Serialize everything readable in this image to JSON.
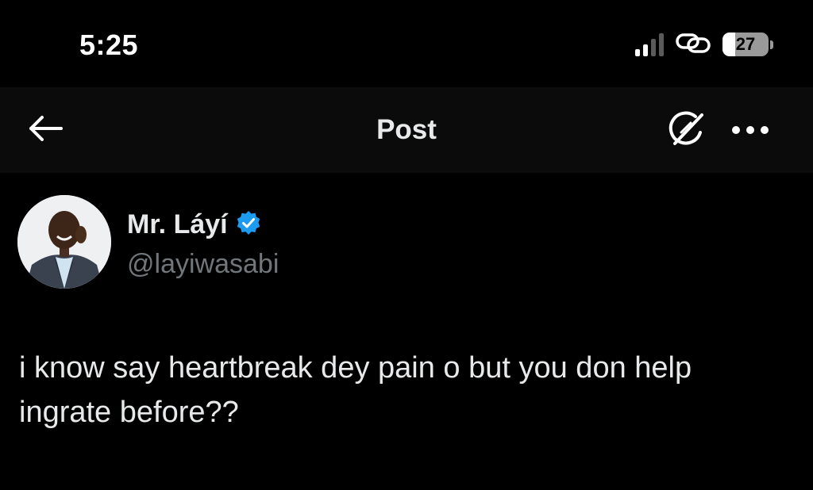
{
  "status_bar": {
    "time": "5:25",
    "battery_level": "27",
    "battery_fraction": 0.27,
    "signal_bars_active": 2,
    "signal_bars_total": 4,
    "icons": [
      "cellular-signal-icon",
      "link-icon",
      "battery-icon"
    ]
  },
  "nav": {
    "title": "Post",
    "back_icon": "arrow-left-icon",
    "grok_icon": "grok-icon",
    "more_icon": "more-horizontal-icon"
  },
  "post": {
    "author_name": "Mr. Láyí",
    "handle": "@layiwasabi",
    "verified": true,
    "verified_color": "#1d9bf0",
    "text": "i know say heartbreak dey pain o but you don help ingrate before??"
  },
  "colors": {
    "background": "#000000",
    "nav_background": "#0b0b0b",
    "primary_text": "#e7e9ea",
    "secondary_text": "#71767b",
    "accent": "#1d9bf0"
  }
}
